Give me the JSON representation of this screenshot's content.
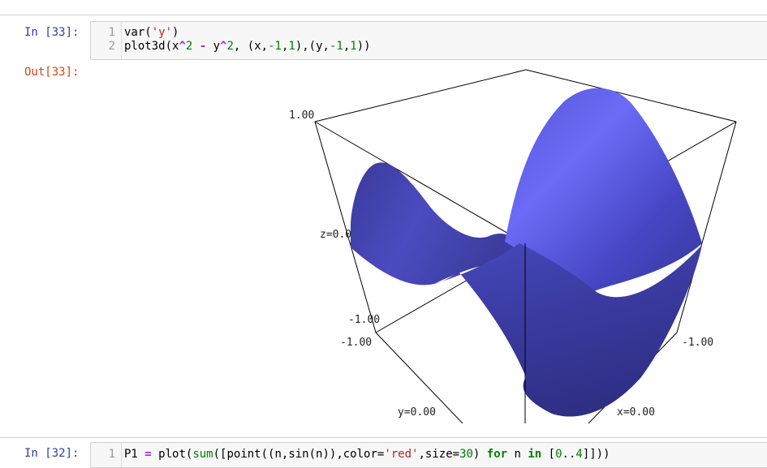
{
  "cell_33": {
    "in_prompt": "In [33]:",
    "out_prompt": "Out[33]:",
    "line_numbers": [
      "1",
      "2"
    ],
    "code": {
      "line1": {
        "fn": "var",
        "open": "(",
        "str": "'y'",
        "close": ")"
      },
      "line2": {
        "fn": "plot3d",
        "p1": "(x",
        "pow1": "^",
        "n2a": "2",
        "sp": " ",
        "minus": "-",
        "y": " y",
        "pow2": "^",
        "n2b": "2",
        "tuple1_open": ", (x,",
        "neg1a": "-1",
        "comma1": ",",
        "one_a": "1",
        "tuple_mid": "),(y,",
        "neg1b": "-1",
        "comma2": ",",
        "one_b": "1",
        "end": "))"
      }
    },
    "plot": {
      "label_z_top": "1.00",
      "label_z_mid": "z=0.0",
      "label_z_bottom": "-1.00",
      "label_y_min": "-1.00",
      "label_x_min": "-1.00",
      "label_y_axis": "y=0.00",
      "label_x_axis": "x=0.00",
      "surface_color": "#5a5ae6"
    }
  },
  "cell_32": {
    "in_prompt": "In [32]:",
    "line_number": "1",
    "code": {
      "a": "P1 ",
      "eq": "=",
      "b": " plot(",
      "sum": "sum",
      "c": "([point((n,sin(n)),color=",
      "str": "'red'",
      "d": ",size=",
      "n30": "30",
      "e": ") ",
      "kw_for": "for",
      "f": " n ",
      "kw_in": "in",
      "g": " [",
      "n0": "0",
      "h": "..",
      "n4": "4",
      "i": "]]))"
    }
  }
}
